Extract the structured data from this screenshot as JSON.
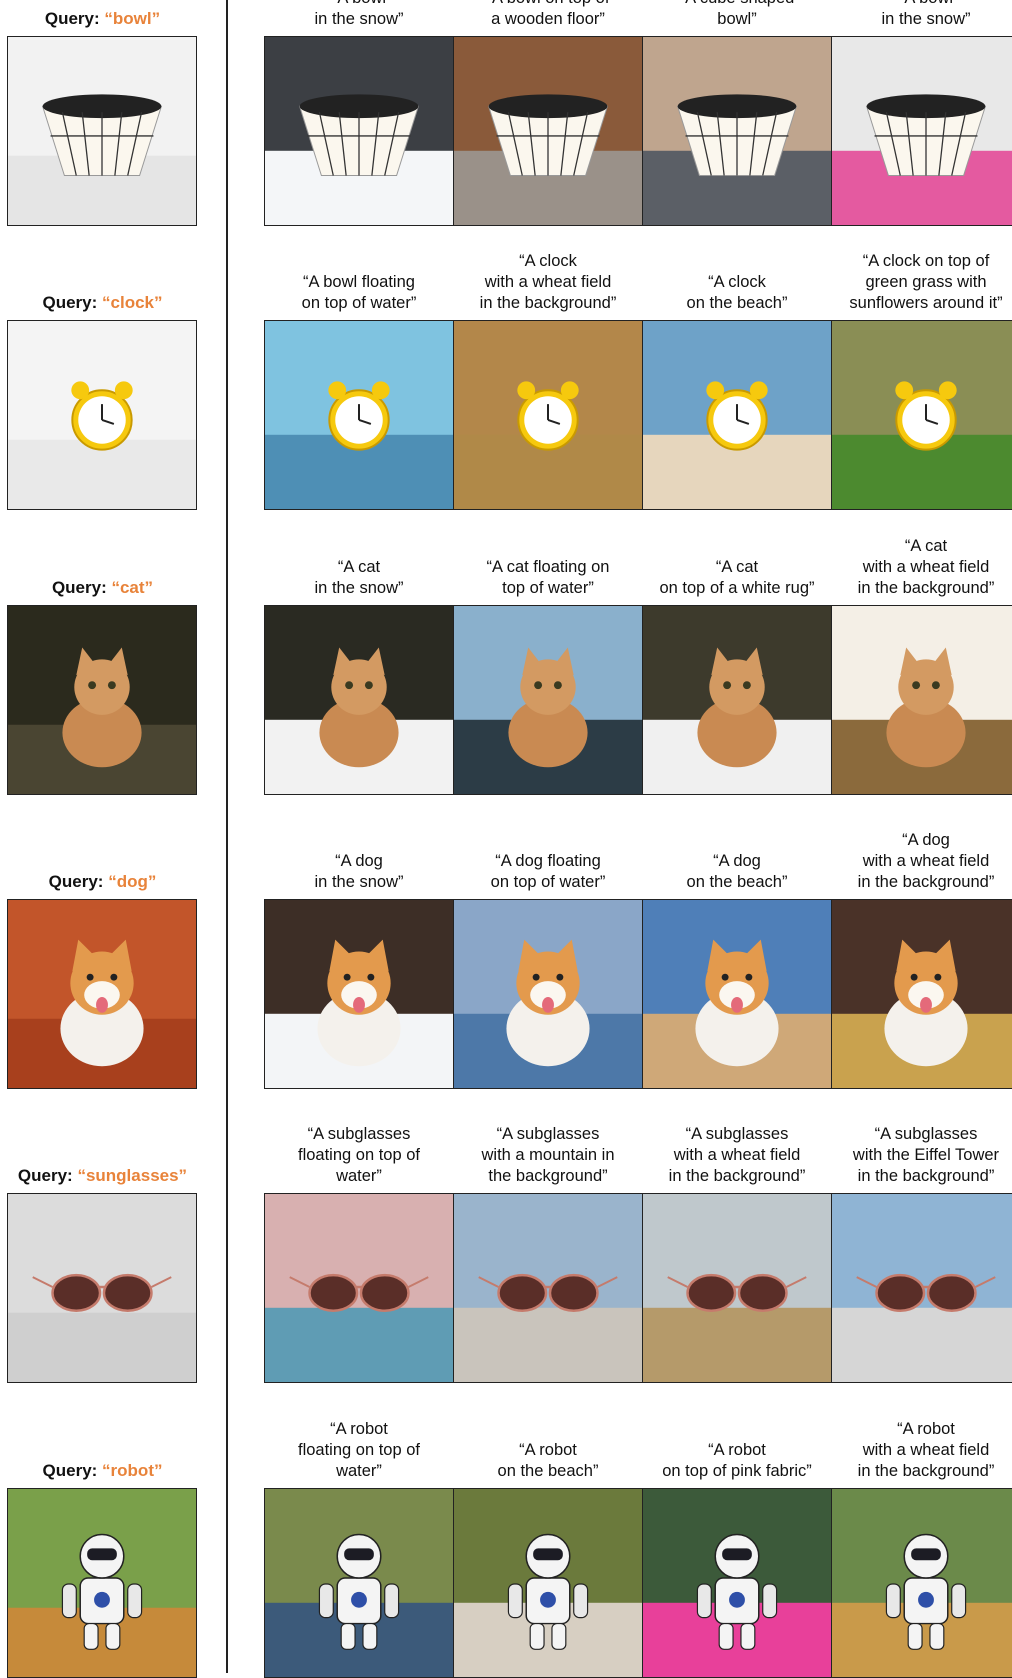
{
  "query_prefix": "Query: ",
  "rows": [
    {
      "word": "“bowl”",
      "query_image": "bowl-photo-icon",
      "captions": [
        "“A bowl\nin the snow”",
        "“A bowl on top of\na wooden floor”",
        "“A cube shaped\nbowl”",
        "“A bowl\nin the snow”"
      ],
      "images": [
        "bowl-in-snow-image",
        "bowl-on-wooden-floor-image",
        "cube-bowl-image",
        "bowl-pink-fabric-image"
      ]
    },
    {
      "word": "“clock”",
      "query_image": "clock-photo-icon",
      "captions": [
        "“A bowl floating\non top of water”",
        "“A clock\nwith a wheat field\nin the background”",
        "“A clock\non the beach”",
        "“A clock on top of\ngreen grass with\nsunflowers around it”"
      ],
      "images": [
        "clock-on-water-image",
        "clock-wheat-field-image",
        "clock-beach-image",
        "clock-sunflowers-image"
      ]
    },
    {
      "word": "“cat”",
      "query_image": "cat-photo-icon",
      "captions": [
        "“A cat\nin the snow”",
        "“A cat floating on\ntop of water”",
        "“A cat\non top of a white rug”",
        "“A cat\nwith a wheat field\nin the background”"
      ],
      "images": [
        "cat-snow-image",
        "cat-water-image",
        "cat-white-rug-image",
        "cat-wheat-field-image"
      ]
    },
    {
      "word": "“dog”",
      "query_image": "dog-photo-icon",
      "captions": [
        "“A dog\nin the snow”",
        "“A dog floating\non top of water”",
        "“A dog\non the beach”",
        "“A dog\nwith a wheat field\nin the background”"
      ],
      "images": [
        "dog-snow-image",
        "dog-water-image",
        "dog-beach-image",
        "dog-wheat-field-image"
      ]
    },
    {
      "word": "“sunglasses”",
      "query_image": "sunglasses-photo-icon",
      "captions": [
        "“A subglasses\nfloating on top of\nwater”",
        "“A subglasses\nwith a mountain in\nthe background”",
        "“A subglasses\nwith a wheat field\nin the background”",
        "“A subglasses\nwith the Eiffel Tower\nin the background”"
      ],
      "images": [
        "sunglasses-water-image",
        "sunglasses-mountain-image",
        "sunglasses-wheat-image",
        "sunglasses-eiffel-image"
      ]
    },
    {
      "word": "“robot”",
      "query_image": "robot-photo-icon",
      "captions": [
        "“A robot\nfloating on top of\nwater”",
        "“A robot\non the beach”",
        "“A robot\non top of pink fabric”",
        "“A robot\nwith a wheat field\nin the background”"
      ],
      "images": [
        "robot-water-image",
        "robot-beach-image",
        "robot-pink-fabric-image",
        "robot-wheat-field-image"
      ]
    }
  ],
  "colors": {
    "accent": "#e8833a",
    "border": "#222222"
  }
}
